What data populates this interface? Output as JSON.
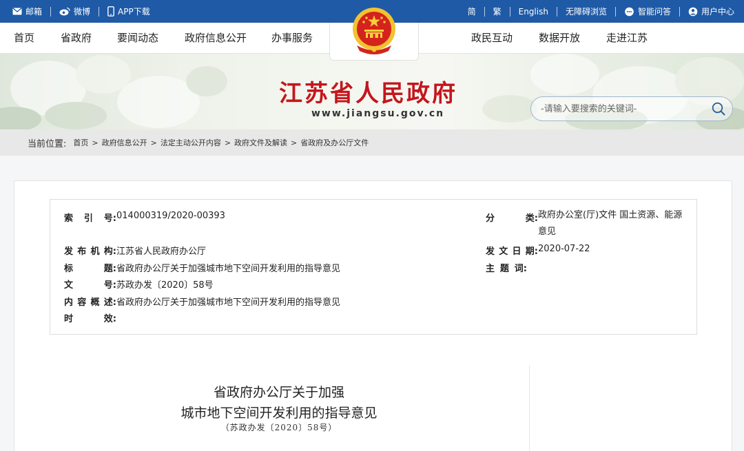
{
  "topbar": {
    "left": [
      {
        "label": "邮箱",
        "icon": "mail-icon"
      },
      {
        "label": "微博",
        "icon": "weibo-icon"
      },
      {
        "label": "APP下载",
        "icon": "phone-icon"
      }
    ],
    "right": {
      "simplified": "简",
      "traditional": "繁",
      "english": "English",
      "accessibility": "无障碍浏览",
      "qa": "智能问答",
      "user_center": "用户中心"
    }
  },
  "nav": {
    "left": [
      "首页",
      "省政府",
      "要闻动态",
      "政府信息公开",
      "办事服务"
    ],
    "right": [
      "政民互动",
      "数据开放",
      "走进江苏"
    ]
  },
  "banner": {
    "title": "江苏省人民政府",
    "url": "www.jiangsu.gov.cn",
    "search_placeholder": "-请输入要搜索的关键词-"
  },
  "breadcrumb": {
    "label": "当前位置:",
    "items": [
      "首页",
      "政府信息公开",
      "法定主动公开内容",
      "政府文件及解读",
      "省政府及办公厅文件"
    ]
  },
  "meta": {
    "index_no": {
      "key": [
        "索",
        "引",
        "号:"
      ],
      "value": "014000319/2020-00393"
    },
    "category": {
      "key": [
        "分",
        "类:"
      ],
      "value": "政府办公室(厅)文件 国土资源、能源 意见"
    },
    "issuer": {
      "key": [
        "发",
        "布",
        "机",
        "构:"
      ],
      "value": "江苏省人民政府办公厅"
    },
    "issue_date": {
      "key": [
        "发",
        "文",
        "日",
        "期:"
      ],
      "value": "2020-07-22"
    },
    "title": {
      "key": [
        "标",
        "题:"
      ],
      "value": "省政府办公厅关于加强城市地下空间开发利用的指导意见"
    },
    "keywords": {
      "key": [
        "主",
        "题",
        "词:"
      ],
      "value": ""
    },
    "doc_no": {
      "key": [
        "文",
        "号:"
      ],
      "value": "苏政办发〔2020〕58号"
    },
    "summary": {
      "key": [
        "内",
        "容",
        "概",
        "述:"
      ],
      "value": "省政府办公厅关于加强城市地下空间开发利用的指导意见"
    },
    "validity": {
      "key": [
        "时",
        "效:"
      ],
      "value": ""
    }
  },
  "document": {
    "title_line1": "省政府办公厅关于加强",
    "title_line2": "城市地下空间开发利用的指导意见",
    "number": "（苏政办发〔2020〕58号）"
  },
  "colors": {
    "topbar": "#1f5aa6",
    "title_red": "#c4161c",
    "breadcrumb_bg": "#e8e8e8"
  }
}
